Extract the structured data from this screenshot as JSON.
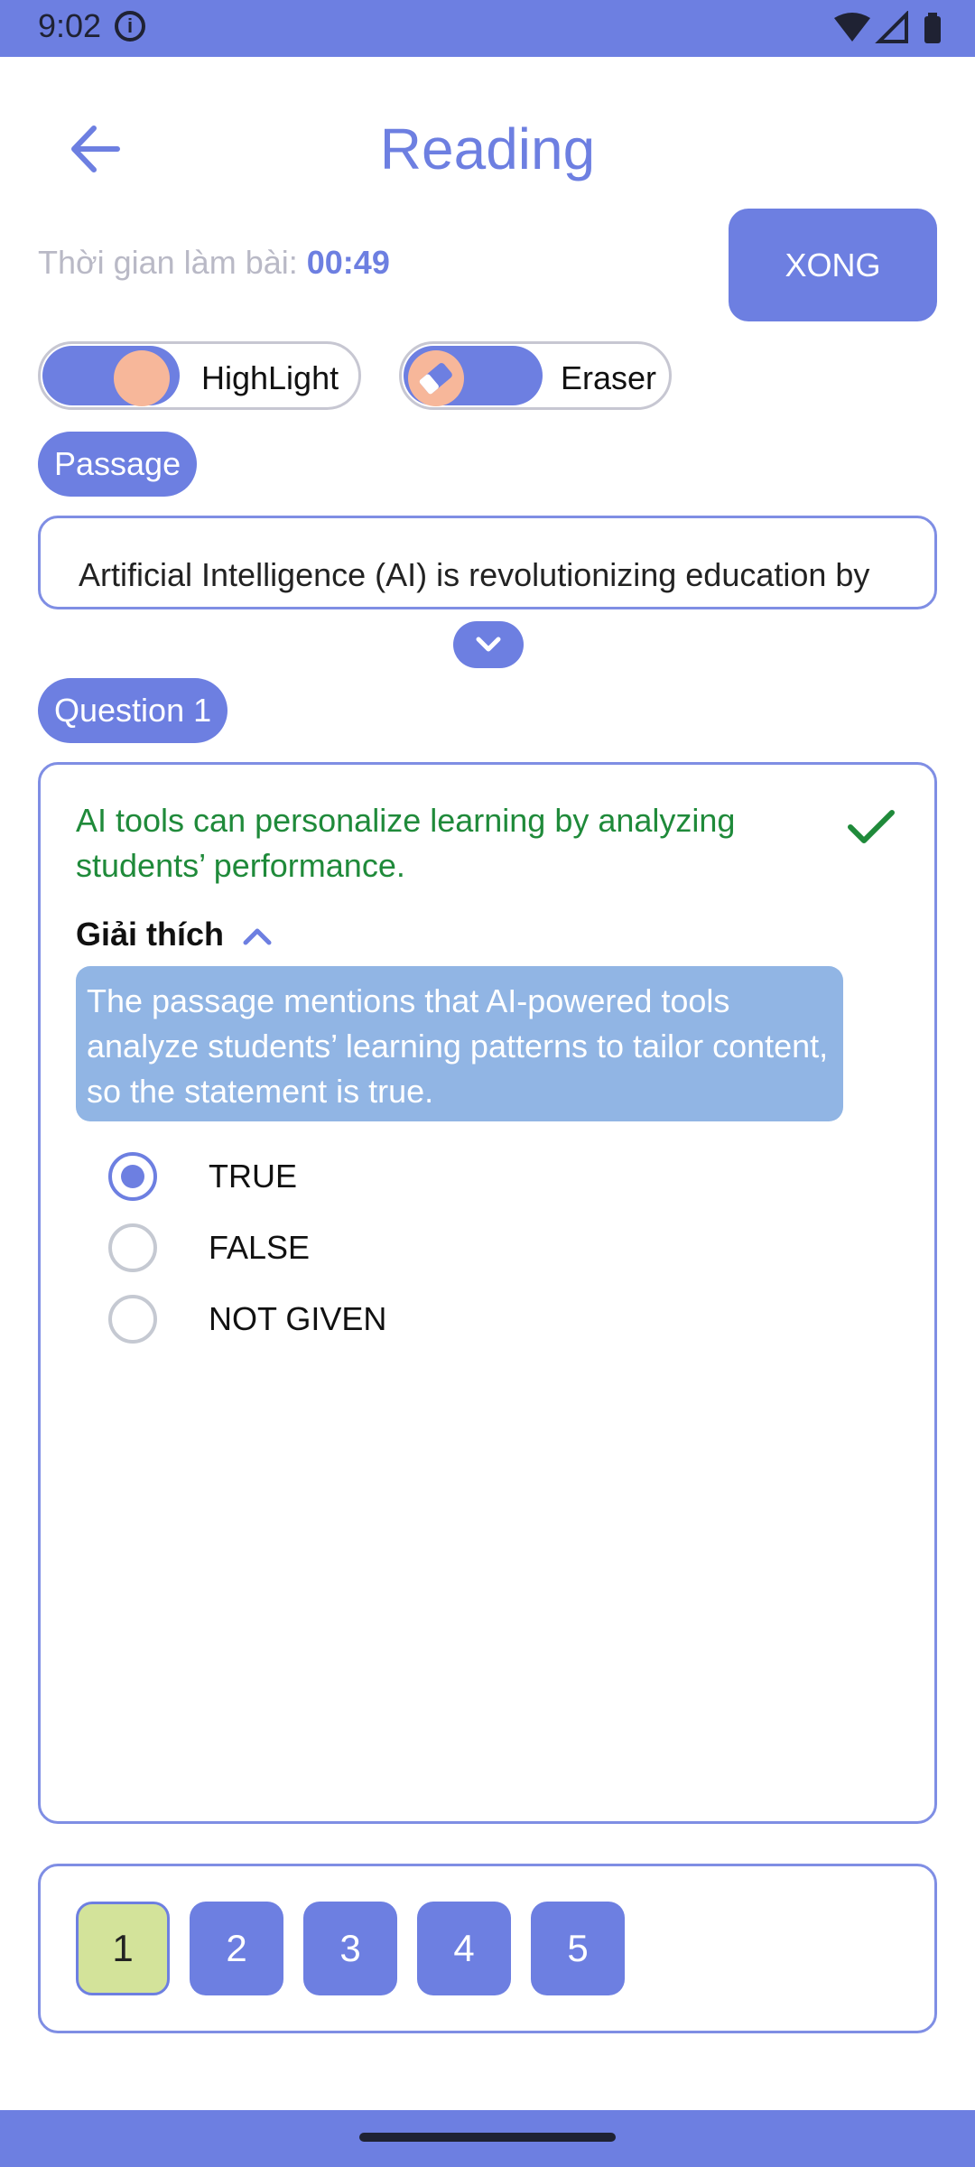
{
  "status_bar": {
    "time": "9:02",
    "info_icon": "info-icon",
    "icons": [
      "wifi-icon",
      "signal-icon",
      "battery-icon"
    ]
  },
  "header": {
    "title": "Reading",
    "back_icon": "arrow-left-icon"
  },
  "timer": {
    "label": "Thời gian làm bài:",
    "value": "00:49"
  },
  "done_button": {
    "label": "XONG"
  },
  "tools": {
    "highlight": {
      "label": "HighLight",
      "on": true
    },
    "eraser": {
      "label": "Eraser",
      "on": false,
      "icon": "eraser-icon"
    }
  },
  "passage": {
    "tag": "Passage",
    "preview": "Artificial Intelligence (AI) is revolutionizing education by",
    "expand_icon": "chevron-down-icon"
  },
  "question": {
    "tag": "Question 1",
    "statement": "AI tools can personalize learning by analyzing students’ performance.",
    "correct_icon": "check-icon",
    "explanation_label": "Giải thích",
    "explanation_toggle_icon": "chevron-up-icon",
    "explanation": "The passage mentions that AI-powered tools analyze students’ learning patterns to tailor content, so the statement is true.",
    "options": [
      "TRUE",
      "FALSE",
      "NOT GIVEN"
    ],
    "selected": "TRUE"
  },
  "question_nav": {
    "numbers": [
      "1",
      "2",
      "3",
      "4",
      "5"
    ],
    "current": "1"
  },
  "colors": {
    "accent": "#6d7fe1",
    "correct": "#1f8a3a",
    "explanation_bg": "#91b5e4",
    "current_question": "#d3e39a",
    "knob": "#f7b79a"
  }
}
